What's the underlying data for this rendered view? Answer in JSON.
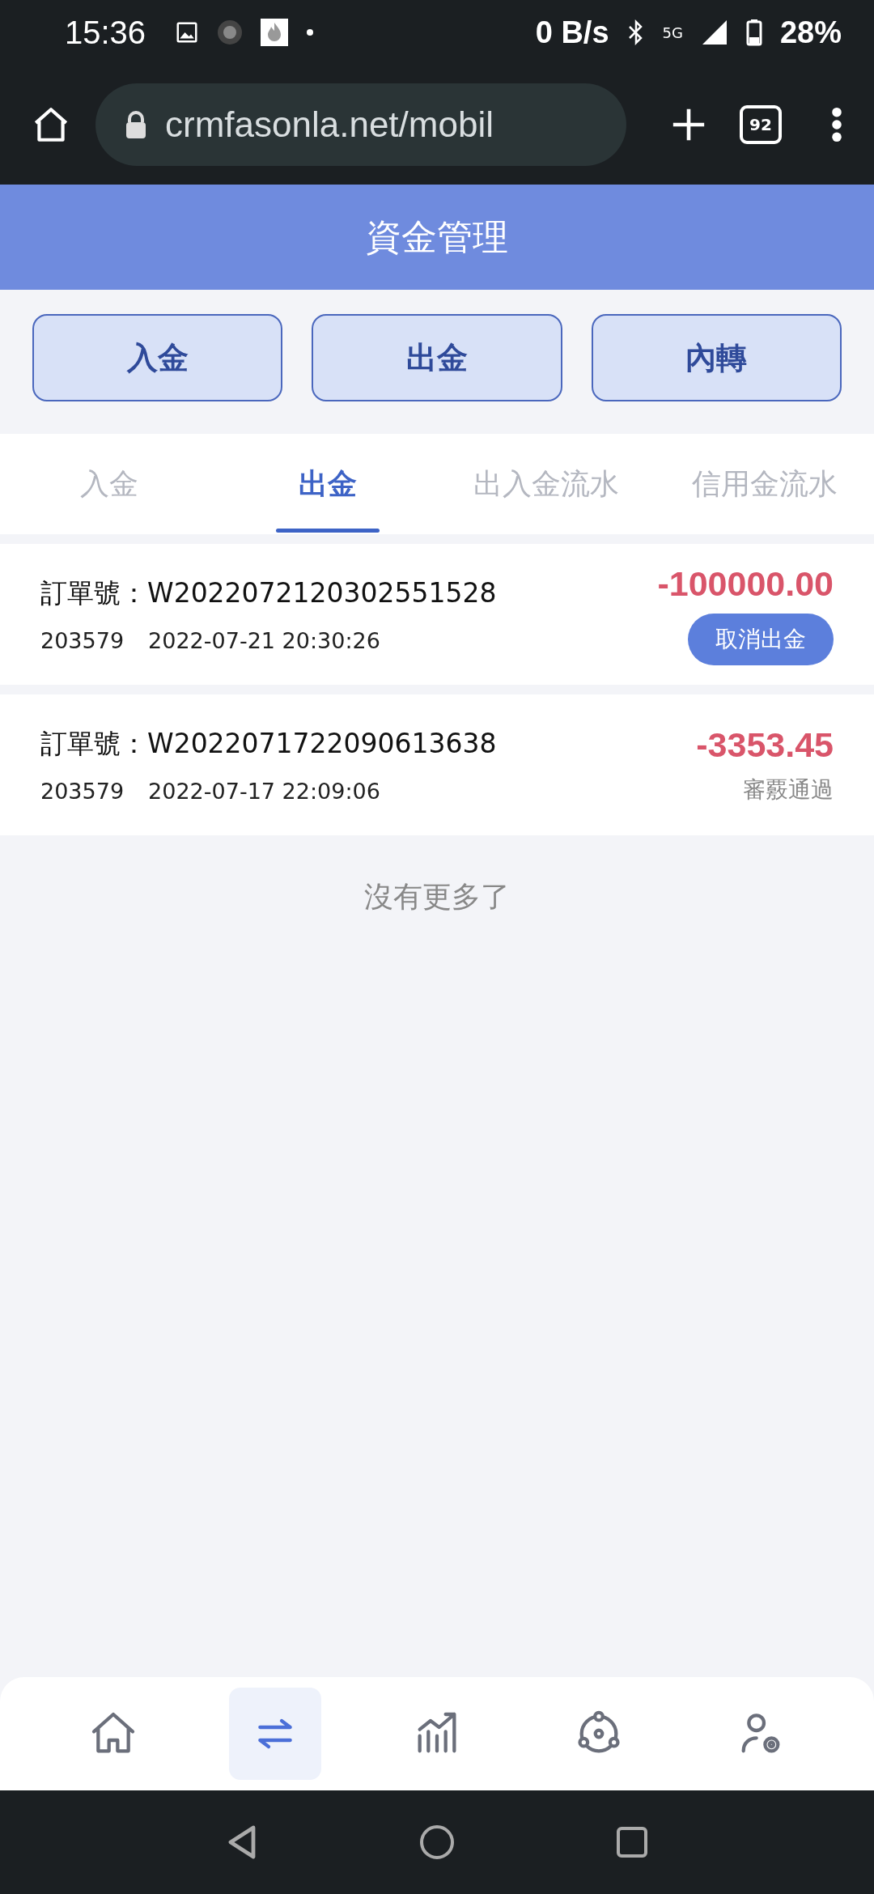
{
  "status_bar": {
    "time": "15:36",
    "net_speed": "0 B/s",
    "network": "5G",
    "battery": "28%"
  },
  "browser": {
    "url": "crmfasonla.net/mobil",
    "tab_count": "92"
  },
  "header": {
    "title": "資金管理"
  },
  "actions": [
    "入金",
    "出金",
    "內轉"
  ],
  "tabs": [
    {
      "label": "入金",
      "selected": false
    },
    {
      "label": "出金",
      "selected": true
    },
    {
      "label": "出入金流水",
      "selected": false
    },
    {
      "label": "信用金流水",
      "selected": false
    }
  ],
  "orders": [
    {
      "kind": "cancelable",
      "order_label": "訂單號：",
      "order_no": "W2022072120302551528",
      "account": "203579",
      "time": "2022-07-21 20:30:26",
      "amount": "-100000.00",
      "action": "取消出金"
    },
    {
      "kind": "status",
      "order_label": "訂單號：",
      "order_no": "W2022071722090613638",
      "account": "203579",
      "time": "2022-07-17 22:09:06",
      "amount": "-3353.45",
      "status": "審覈通過"
    }
  ],
  "list_end": "沒有更多了",
  "bottom_nav": [
    {
      "selected": false
    },
    {
      "selected": true
    },
    {
      "selected": false
    },
    {
      "selected": false
    },
    {
      "selected": false
    }
  ]
}
